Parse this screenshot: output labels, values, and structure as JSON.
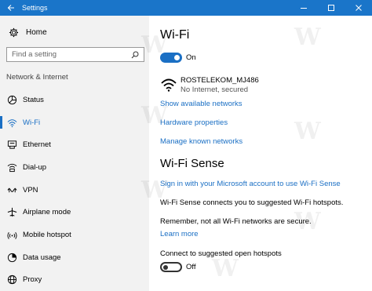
{
  "window": {
    "title": "Settings"
  },
  "sidebar": {
    "home_label": "Home",
    "search_placeholder": "Find a setting",
    "section_title": "Network & Internet",
    "items": [
      {
        "label": "Status",
        "icon": "status-icon"
      },
      {
        "label": "Wi-Fi",
        "icon": "wifi-icon",
        "active": true
      },
      {
        "label": "Ethernet",
        "icon": "ethernet-icon"
      },
      {
        "label": "Dial-up",
        "icon": "dialup-icon"
      },
      {
        "label": "VPN",
        "icon": "vpn-icon"
      },
      {
        "label": "Airplane mode",
        "icon": "airplane-icon"
      },
      {
        "label": "Mobile hotspot",
        "icon": "hotspot-icon"
      },
      {
        "label": "Data usage",
        "icon": "data-usage-icon"
      },
      {
        "label": "Proxy",
        "icon": "globe-icon"
      }
    ]
  },
  "main": {
    "title": "Wi-Fi",
    "wifi_toggle": {
      "state": "On"
    },
    "network": {
      "name": "ROSTELEKOM_MJ486",
      "status": "No Internet, secured"
    },
    "links": {
      "show_available": "Show available networks",
      "hardware": "Hardware properties",
      "manage_known": "Manage known networks"
    },
    "sense": {
      "title": "Wi-Fi Sense",
      "signin_link": "Sign in with your Microsoft account to use Wi-Fi Sense",
      "desc": "Wi-Fi Sense connects you to suggested Wi-Fi hotspots.",
      "remember": "Remember, not all Wi-Fi networks are secure.",
      "learn_more": "Learn more",
      "hotspots_label": "Connect to suggested open hotspots",
      "hotspots_toggle": {
        "state": "Off"
      }
    }
  },
  "colors": {
    "accent": "#1a6fc4",
    "titlebar": "#1a75c9",
    "sidebar_bg": "#f2f2f2"
  }
}
